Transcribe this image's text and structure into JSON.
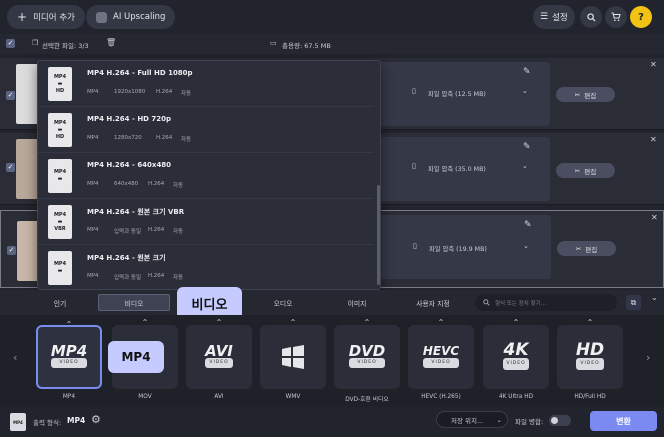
{
  "header": {
    "add_media_label": "미디어 추가",
    "ai_upscaling_label": "AI Upscaling",
    "settings_label": "설정"
  },
  "selection": {
    "selected_label": "선택한 파일: 3/3",
    "total_label": "총용량: 67.5 MB"
  },
  "rows": [
    {
      "compress_label": "파일 압축 (12.5 MB)",
      "edit_label": "편집"
    },
    {
      "compress_label": "파일 압축 (35.0 MB)",
      "edit_label": "편집"
    },
    {
      "compress_label": "파일 압축 (19.9 MB)",
      "edit_label": "편집"
    }
  ],
  "presets": [
    {
      "title": "MP4 H.264 - Full HD 1080p",
      "meta": [
        "MP4",
        "1920x1080",
        "H.264",
        "자동"
      ],
      "icon_label": "HD"
    },
    {
      "title": "MP4 H.264 - HD 720p",
      "meta": [
        "MP4",
        "1280x720",
        "H.264",
        "자동"
      ],
      "icon_label": "HD"
    },
    {
      "title": "MP4 H.264 - 640x480",
      "meta": [
        "MP4",
        "640x480",
        "H.264",
        "자동"
      ],
      "icon_label": ""
    },
    {
      "title": "MP4 H.264 - 원본 크기 VBR",
      "meta": [
        "MP4",
        "입력과 동일",
        "H.264",
        "자동"
      ],
      "icon_label": "VBR"
    },
    {
      "title": "MP4 H.264 - 원본 크기",
      "meta": [
        "MP4",
        "입력과 동일",
        "H.264",
        "자동"
      ],
      "icon_label": ""
    }
  ],
  "tabs": [
    "인기",
    "비디오",
    "오디오",
    "이미지",
    "사용자 지정"
  ],
  "search_placeholder": "형식 또는 장치 찾기...",
  "callouts": {
    "video": "비디오",
    "mp4": "MP4"
  },
  "formats": [
    {
      "logo": "MP4",
      "sub": "VIDEO",
      "label": "MP4"
    },
    {
      "logo": "",
      "sub": "",
      "label": "MOV"
    },
    {
      "logo": "AVI",
      "sub": "VIDEO",
      "label": "AVI"
    },
    {
      "logo": "",
      "sub": "",
      "label": "WMV"
    },
    {
      "logo": "DVD",
      "sub": "VIDEO",
      "label": "DVD-호환 비디오"
    },
    {
      "logo": "HEVC",
      "sub": "VIDEO",
      "label": "HEVC (H.265)"
    },
    {
      "logo": "4K",
      "sub": "VIDEO",
      "label": "4K Ultra HD"
    },
    {
      "logo": "HD",
      "sub": "VIDEO",
      "label": "HD/Full HD"
    }
  ],
  "footer": {
    "output_label": "출력 형식:",
    "output_value": "MP4",
    "save_label": "저장 위치...",
    "merge_label": "파일 병합:",
    "convert_label": "변환"
  },
  "colors": {
    "accent": "#7a8af0",
    "callout": "#c5cbff"
  }
}
